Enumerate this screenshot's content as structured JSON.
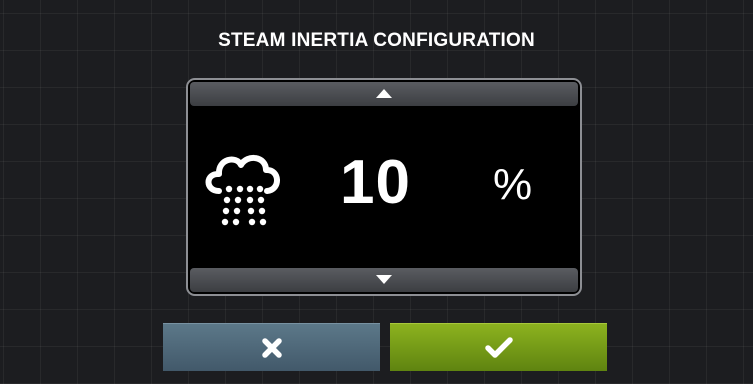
{
  "screen": {
    "title": "STEAM INERTIA CONFIGURATION"
  },
  "setting": {
    "value": "10",
    "unit": "%",
    "icon": "steam-icon"
  },
  "controls": {
    "increase_icon": "triangle-up-icon",
    "decrease_icon": "triangle-down-icon",
    "cancel_icon": "close-icon",
    "confirm_icon": "checkmark-icon"
  },
  "colors": {
    "cancel_button": "#4f6a7b",
    "confirm_button": "#78a018",
    "panel_background": "#000000",
    "page_background": "#1c1d20"
  }
}
